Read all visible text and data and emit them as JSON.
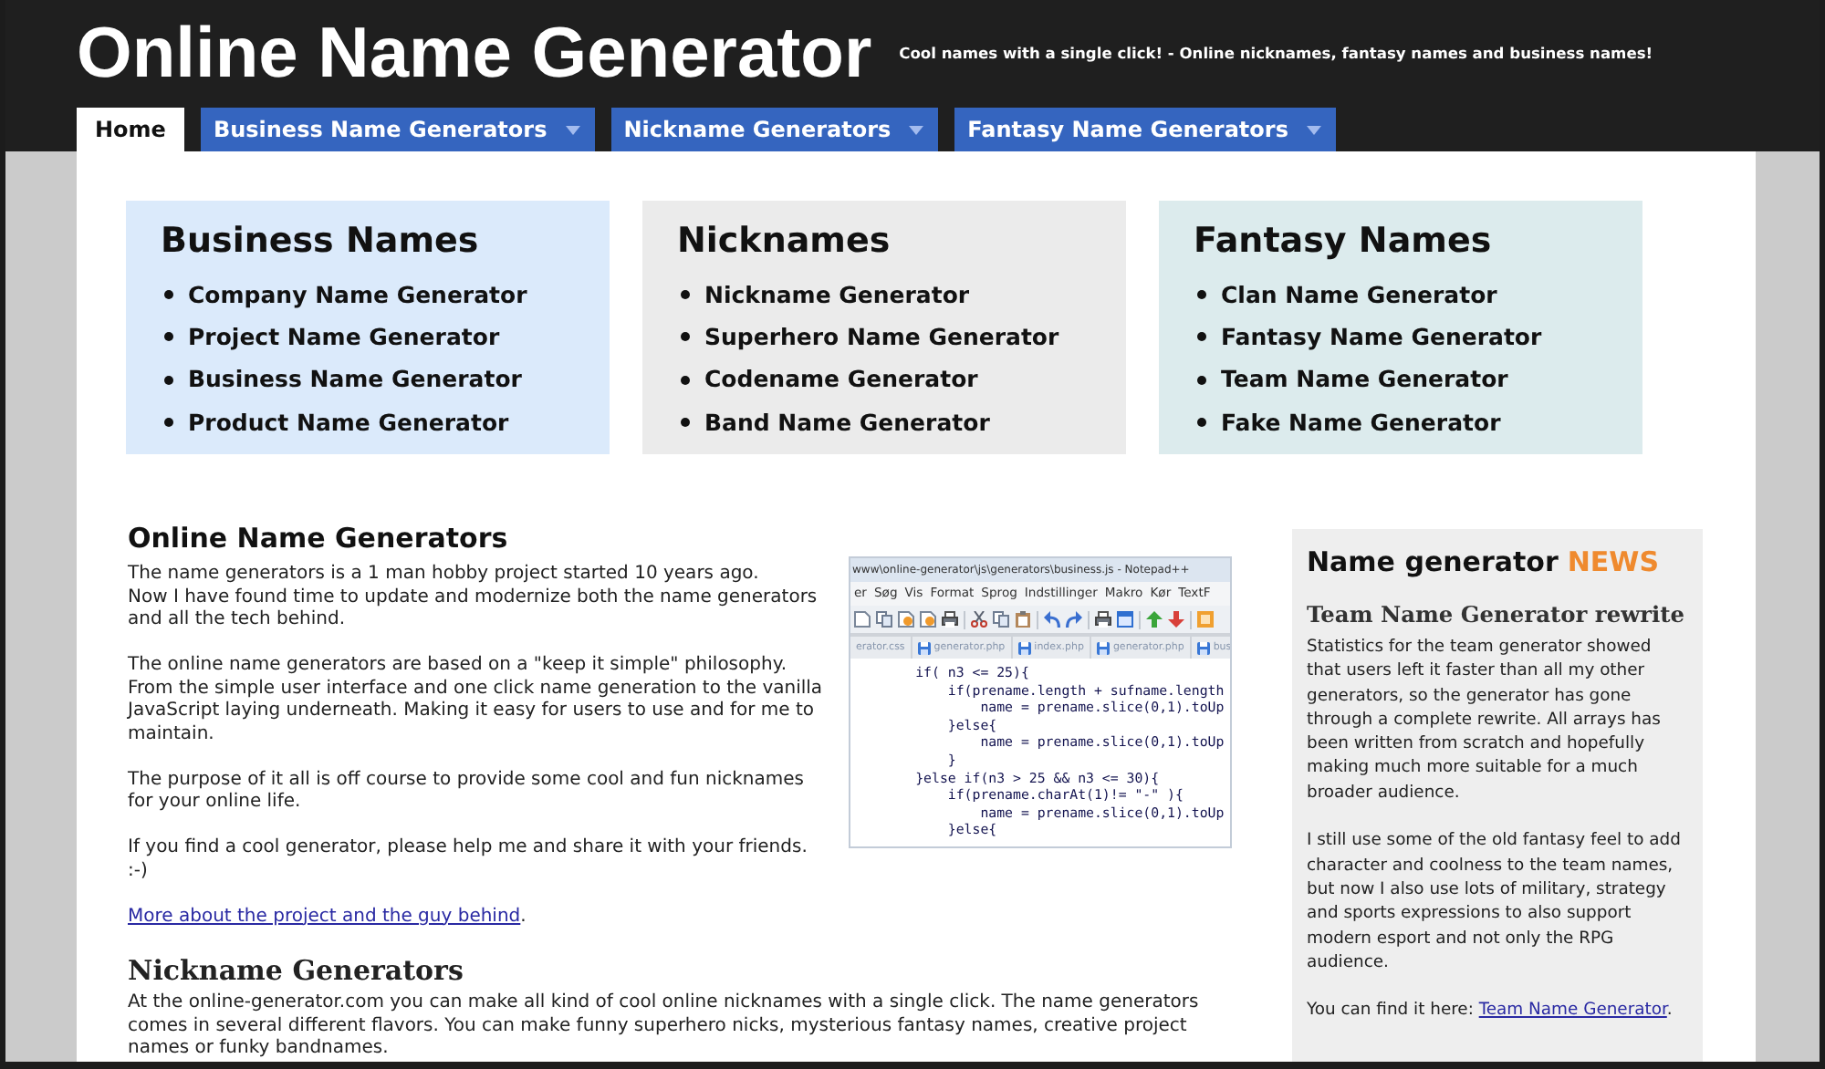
{
  "header": {
    "title": "Online Name Generator",
    "tagline": "Cool names with a single click! - Online nicknames, fantasy names and business names!"
  },
  "nav": [
    {
      "label": "Home",
      "selected": true,
      "kind": "link"
    },
    {
      "label": "Business Name Generators",
      "selected": false,
      "kind": "dropdown"
    },
    {
      "label": "Nickname Generators",
      "selected": false,
      "kind": "dropdown"
    },
    {
      "label": "Fantasy Name Generators",
      "selected": false,
      "kind": "dropdown"
    }
  ],
  "categories": [
    {
      "title": "Business Names",
      "color": "#dbeafb",
      "items": [
        "Company Name Generator",
        "Project Name Generator",
        "Business Name Generator",
        "Product Name Generator"
      ]
    },
    {
      "title": "Nicknames",
      "color": "#ebebeb",
      "items": [
        "Nickname Generator",
        "Superhero Name Generator",
        "Codename Generator",
        "Band Name Generator"
      ]
    },
    {
      "title": "Fantasy Names",
      "color": "#dcebed",
      "items": [
        "Clan Name Generator",
        "Fantasy Name Generator",
        "Team Name Generator",
        "Fake Name Generator"
      ]
    }
  ],
  "intro": {
    "heading": "Online Name Generators",
    "paragraphs": [
      "The name generators is a 1 man hobby project started 10 years ago.\nNow I have found time to update and modernize both the name generators and all the tech behind.",
      "The online name generators are based on a \"keep it simple\" philosophy.\nFrom the simple user interface and one click name generation to the vanilla JavaScript laying underneath. Making it easy for users to use and for me to maintain.",
      "The purpose of it all is off course to provide some cool and fun nicknames for your online life.",
      "If you find a cool generator, please help me and share it with your friends. :-)"
    ],
    "link": {
      "text": "More about the project and the guy behind",
      "after": "."
    }
  },
  "editor": {
    "title": "www\\online-generator\\js\\generators\\business.js - Notepad++",
    "menu": [
      "er",
      "Søg",
      "Vis",
      "Format",
      "Sprog",
      "Indstillinger",
      "Makro",
      "Kør",
      "TextF"
    ],
    "tabs": [
      {
        "label": "erator.css",
        "icon": false
      },
      {
        "label": "generator.php",
        "icon": true
      },
      {
        "label": "index.php",
        "icon": true
      },
      {
        "label": "generator.php",
        "icon": true
      },
      {
        "label": "bus",
        "icon": true
      }
    ],
    "code": [
      "        if( n3 <= 25){",
      "            if(prename.length + sufname.length",
      "                name = prename.slice(0,1).toUp",
      "            }else{",
      "                name = prename.slice(0,1).toUp",
      "            }",
      "        }else if(n3 > 25 && n3 <= 30){",
      "            if(prename.charAt(1)!= \"-\" ){",
      "                name = prename.slice(0,1).toUp",
      "            }else{"
    ]
  },
  "article": {
    "heading": "Nickname Generators",
    "text": "At the online-generator.com you can make all kind of cool online nicknames with a single click. The name generators comes in several different flavors. You can make funny superhero nicks, mysterious fantasy names, creative project names or funky bandnames."
  },
  "news": {
    "title": "Name generator",
    "highlight": "NEWS",
    "headline": "Team Name Generator rewrite",
    "paragraphs": [
      "Statistics for the team generator showed that users left it faster than all my other generators, so the generator has gone through a complete rewrite. All arrays has been written from scratch and hopefully making much more suitable for a much broader audience.",
      "I still use some of the old fantasy feel to add character and coolness to the team names, but now I also use lots of military, strategy and sports expressions to also support modern esport and not only the RPG audience."
    ],
    "link_line": {
      "before": "You can find it here: ",
      "link": "Team Name Generator",
      "after": "."
    }
  }
}
